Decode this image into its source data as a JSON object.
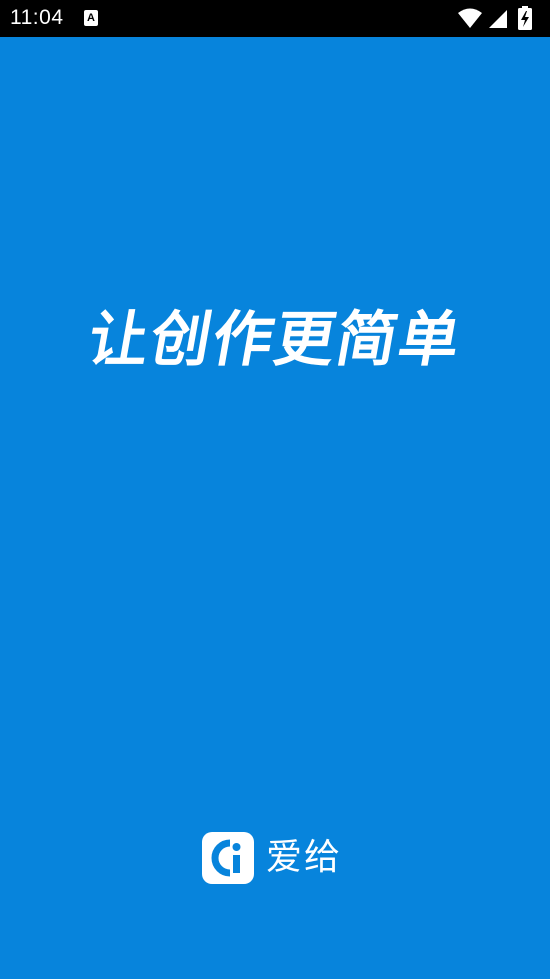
{
  "status_bar": {
    "time": "11:04",
    "notification_icon_letter": "A",
    "icons": [
      "wifi-icon",
      "cell-signal-icon",
      "battery-charging-icon"
    ]
  },
  "splash": {
    "slogan": "让创作更简单",
    "brand_name": "爱给",
    "logo_icon": "aigei-logo-icon"
  },
  "colors": {
    "background": "#0784dc",
    "status_bar": "#000000",
    "foreground": "#ffffff"
  }
}
